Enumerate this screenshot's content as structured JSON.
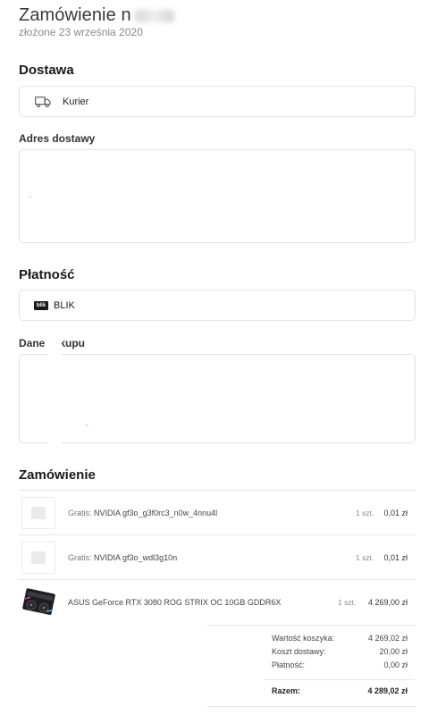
{
  "header": {
    "title": "Zamówienie n",
    "subtitle": "złożone 23 września 2020"
  },
  "delivery": {
    "section_title": "Dostawa",
    "method": "Kurier",
    "method_icon": "truck-icon",
    "address_label": "Adres dostawy"
  },
  "payment": {
    "section_title": "Płatność",
    "method": "BLIK",
    "method_icon": "blik-logo-icon",
    "purchase_data_label": "Dane zakupu"
  },
  "order": {
    "section_title": "Zamówienie",
    "items": [
      {
        "prefix": "Gratis:",
        "name": "NVIDIA gf3o_g3f0rc3_n0w_4nnu4l",
        "qty": "1 szt.",
        "price": "0,01 zł"
      },
      {
        "prefix": "Gratis:",
        "name": "NVIDIA gf3o_wdl3g10n",
        "qty": "1 szt.",
        "price": "0,01 zł"
      },
      {
        "prefix": "",
        "name": "ASUS GeForce RTX 3080 ROG STRIX OC 10GB GDDR6X",
        "qty": "1 szt.",
        "price": "4 269,00 zł"
      }
    ],
    "summary": {
      "cart_value_label": "Wartość koszyka:",
      "cart_value": "4 269,02 zł",
      "shipping_label": "Koszt dostawy:",
      "shipping_value": "20,00 zł",
      "payment_label": "Płatność:",
      "payment_value": "0,00 zł",
      "total_label": "Razem:",
      "total_value": "4 289,02 zł"
    }
  }
}
